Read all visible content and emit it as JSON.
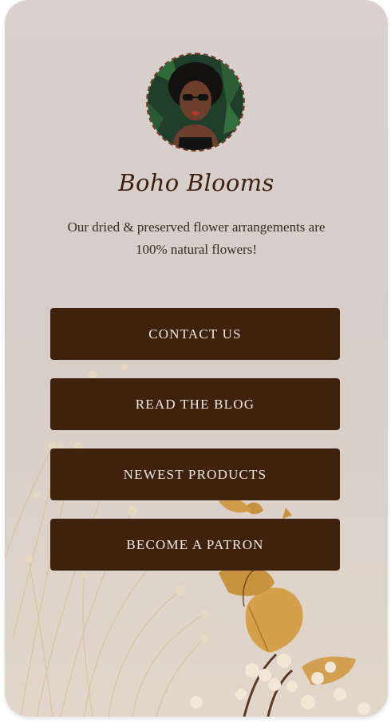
{
  "profile": {
    "title": "Boho Blooms",
    "description": "Our dried & preserved flower arrangements are 100% natural flowers!"
  },
  "links": [
    {
      "label": "CONTACT US"
    },
    {
      "label": "READ THE BLOG"
    },
    {
      "label": "NEWEST PRODUCTS"
    },
    {
      "label": "BECOME A PATRON"
    }
  ],
  "colors": {
    "background": "#d8d0cc",
    "button": "#3e220e",
    "button_text": "#f1e8e2",
    "title": "#3b1f10"
  },
  "icons": {
    "avatar": "profile-photo",
    "background": "dried-flowers-photo"
  }
}
